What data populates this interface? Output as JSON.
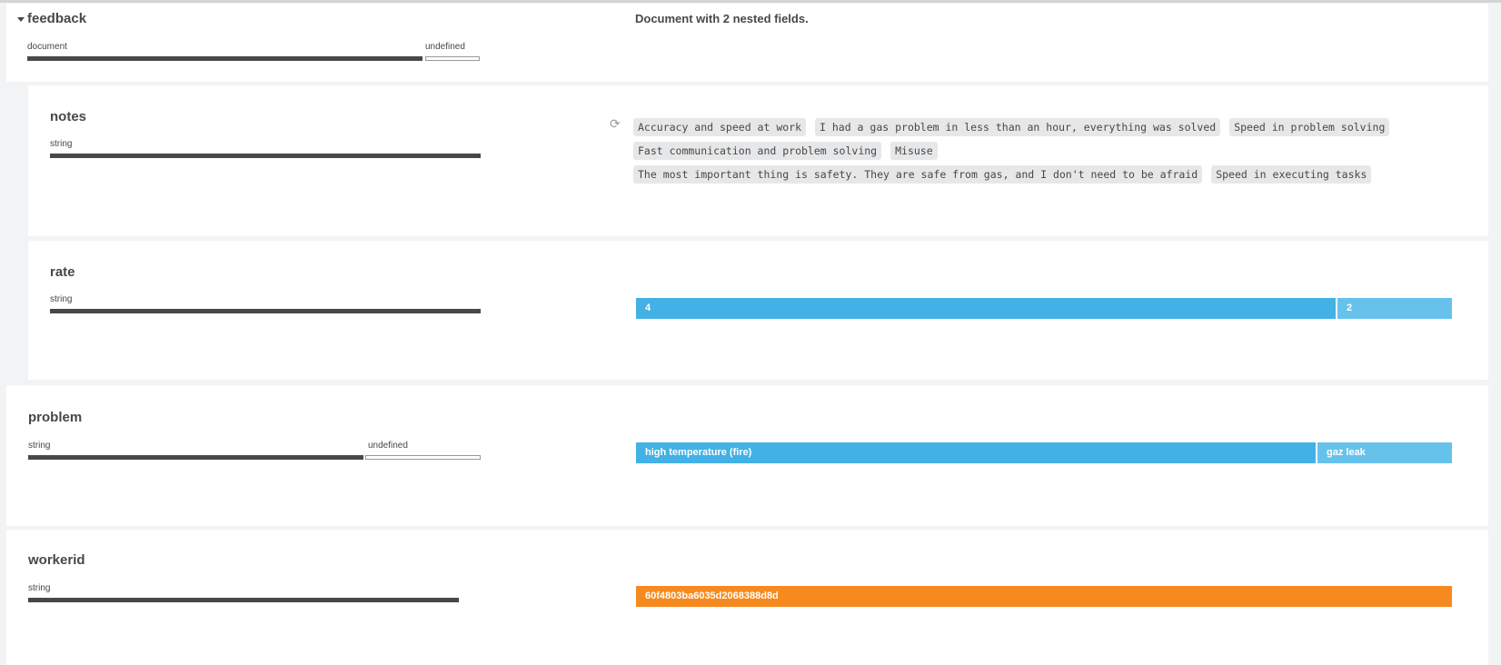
{
  "colors": {
    "primary_bar": "#43b1e5",
    "secondary_bar": "#67c2eb",
    "unique_bar": "#f68a1e",
    "type_bar": "#494747"
  },
  "feedback": {
    "name": "feedback",
    "toggle_icon": "caret-down-icon",
    "type_label": "document",
    "undefined_label": "undefined",
    "description": "Document with 2 nested fields."
  },
  "notes": {
    "name": "notes",
    "type_label": "string",
    "refresh_icon": "refresh-icon",
    "values": [
      "Accuracy and speed at work",
      "I had a gas problem in less than an hour, everything was solved",
      "Speed in problem solving",
      "Fast communication and problem solving",
      "Misuse",
      "The most important thing is safety. They are safe from gas, and I don't need to be afraid",
      "Speed in executing tasks"
    ]
  },
  "rate": {
    "name": "rate",
    "type_label": "string",
    "values": [
      {
        "label": "4",
        "share": 0.86
      },
      {
        "label": "2",
        "share": 0.14
      }
    ]
  },
  "problem": {
    "name": "problem",
    "type_label": "string",
    "undefined_label": "undefined",
    "type_share": 0.79,
    "values": [
      {
        "label": "high temperature (fire)",
        "share": 0.835
      },
      {
        "label": "gaz leak",
        "share": 0.165
      }
    ]
  },
  "workerid": {
    "name": "workerid",
    "type_label": "string",
    "values": [
      {
        "label": "60f4803ba6035d2068388d8d",
        "share": 1.0
      }
    ]
  }
}
